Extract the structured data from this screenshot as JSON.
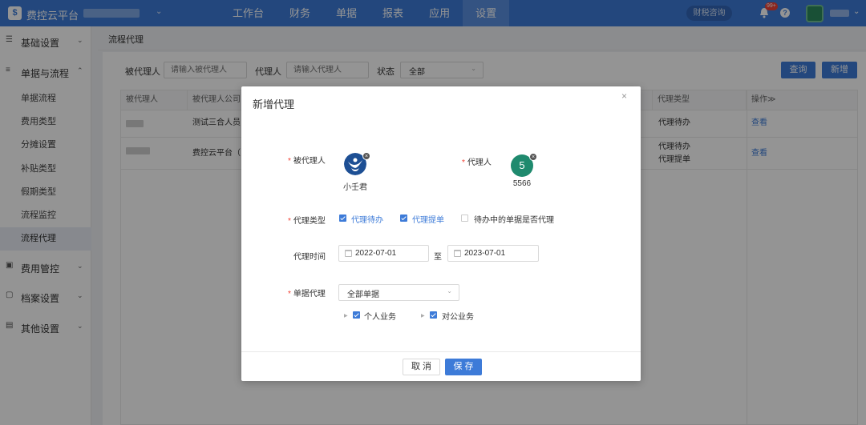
{
  "app": {
    "name": "费控云平台"
  },
  "topnav": {
    "items": [
      {
        "label": "工作台"
      },
      {
        "label": "财务"
      },
      {
        "label": "单据"
      },
      {
        "label": "报表"
      },
      {
        "label": "应用"
      },
      {
        "label": "设置"
      }
    ],
    "active_index": 5,
    "tax_consult": "财税咨询",
    "notification_badge": "99+",
    "help": "?"
  },
  "sidebar": {
    "groups": [
      {
        "icon": "sliders-icon",
        "label": "基础设置",
        "expanded": false
      },
      {
        "icon": "list-icon",
        "label": "单据与流程",
        "expanded": true,
        "items": [
          "单据流程",
          "费用类型",
          "分摊设置",
          "补贴类型",
          "假期类型",
          "流程监控",
          "流程代理"
        ],
        "active_item": "流程代理"
      },
      {
        "icon": "wallet-icon",
        "label": "费用管控",
        "expanded": false
      },
      {
        "icon": "folder-icon",
        "label": "档案设置",
        "expanded": false
      },
      {
        "icon": "box-icon",
        "label": "其他设置",
        "expanded": false
      }
    ]
  },
  "page": {
    "breadcrumb": "流程代理",
    "filters": {
      "principal_label": "被代理人",
      "principal_placeholder": "请输入被代理人",
      "agent_label": "代理人",
      "agent_placeholder": "请输入代理人",
      "status_label": "状态",
      "status_value": "全部"
    },
    "query_button": "查询",
    "add_button": "新增",
    "table": {
      "headers": [
        "被代理人",
        "被代理人公司",
        "代理类型",
        "操作≫"
      ],
      "rows": [
        {
          "company": "测试三合人员",
          "types": [
            "代理待办"
          ],
          "action": "查看"
        },
        {
          "company": "费控云平台（",
          "types": [
            "代理待办",
            "代理提单"
          ],
          "action": "查看"
        }
      ]
    }
  },
  "modal": {
    "title": "新增代理",
    "close": "×",
    "principal_label": "被代理人",
    "principal_name": "小壬君",
    "agent_label": "代理人",
    "agent_avatar_text": "5",
    "agent_name": "5566",
    "agent_avatar_color": "#1f8a6e",
    "type_label": "代理类型",
    "types": [
      {
        "label": "代理待办",
        "checked": true
      },
      {
        "label": "代理提单",
        "checked": true
      },
      {
        "label": "待办中的单据是否代理",
        "checked": false
      }
    ],
    "time_label": "代理时间",
    "start_date": "2022-07-01",
    "to": "至",
    "end_date": "2023-07-01",
    "doc_label": "单据代理",
    "doc_value": "全部单据",
    "doc_tree": [
      {
        "label": "个人业务",
        "checked": true
      },
      {
        "label": "对公业务",
        "checked": true
      }
    ],
    "cancel": "取 消",
    "save": "保 存"
  },
  "colors": {
    "primary": "#3d7bd8",
    "required": "#f04134"
  }
}
